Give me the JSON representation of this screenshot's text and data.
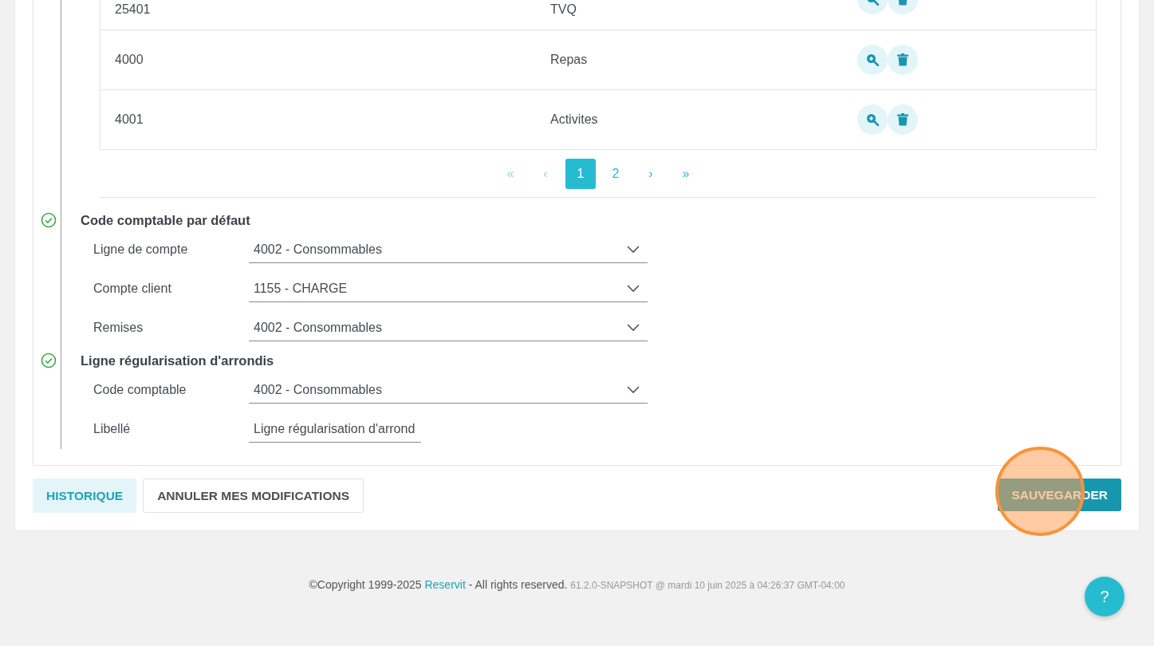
{
  "table": {
    "rows": [
      {
        "code": "25401",
        "label": "TVQ"
      },
      {
        "code": "4000",
        "label": "Repas"
      },
      {
        "code": "4001",
        "label": "Activites"
      }
    ]
  },
  "pagination": [
    {
      "kind": "first",
      "label": "«",
      "selected": false
    },
    {
      "kind": "prev",
      "label": "‹",
      "selected": false
    },
    {
      "kind": "page",
      "label": "1",
      "selected": true
    },
    {
      "kind": "page",
      "label": "2",
      "selected": false
    },
    {
      "kind": "next",
      "label": "›",
      "selected": false
    },
    {
      "kind": "last",
      "label": "»",
      "selected": false
    }
  ],
  "sections": [
    {
      "title": "Code comptable par défaut",
      "done": true,
      "fields": [
        {
          "kind": "select",
          "label": "Ligne de compte",
          "value": "4002 - Consommables"
        },
        {
          "kind": "select",
          "label": "Compte client",
          "value": "1155 - CHARGE"
        },
        {
          "kind": "select",
          "label": "Remises",
          "value": "4002 - Consommables"
        }
      ]
    },
    {
      "title": "Ligne régularisation d'arrondis",
      "done": true,
      "fields": [
        {
          "kind": "select",
          "label": "Code comptable",
          "value": "4002 - Consommables"
        },
        {
          "kind": "text",
          "label": "Libellé",
          "value": "Ligne régularisation d'arrond"
        }
      ]
    }
  ],
  "buttons": [
    {
      "kind": "history",
      "label": "HISTORIQUE"
    },
    {
      "kind": "cancel",
      "label": "ANNULER MES MODIFICATIONS"
    },
    {
      "kind": "save",
      "label": "SAUVEGARDER",
      "highlighted": true
    }
  ],
  "footer": {
    "copyright": "©Copyright 1999-2025",
    "brand": "Reservit",
    "rights": "- All rights reserved.",
    "version": "61.2.0-SNAPSHOT @ mardi 10 juin 2025 à 04:26:37 GMT-04:00"
  },
  "help_button": "?"
}
